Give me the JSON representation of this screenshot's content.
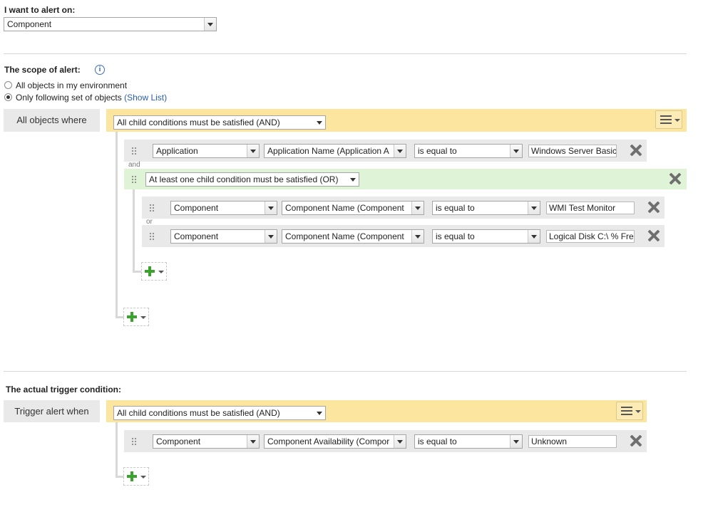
{
  "alert_on": {
    "label": "I want to alert on:",
    "value": "Component"
  },
  "scope": {
    "title": "The scope of alert:",
    "info_icon": "info-icon",
    "options": [
      {
        "label": "All objects in my environment",
        "selected": false
      },
      {
        "label": "Only following set of objects",
        "selected": true
      }
    ],
    "show_list": "(Show List)",
    "side_label": "All objects where",
    "root_condition": "All child conditions must be satisfied (AND)",
    "and_label": "and",
    "row1": {
      "object": "Application",
      "property": "Application Name (Application A",
      "operator": "is equal to",
      "value": "Windows Server Basic"
    },
    "or_group": {
      "condition": "At least one child condition must be satisfied (OR)",
      "or_label": "or",
      "rows": [
        {
          "object": "Component",
          "property": "Component Name (Component",
          "operator": "is equal to",
          "value": "WMI Test Monitor"
        },
        {
          "object": "Component",
          "property": "Component Name (Component",
          "operator": "is equal to",
          "value": "Logical Disk C:\\ % Fre"
        }
      ]
    }
  },
  "trigger": {
    "title": "The actual trigger condition:",
    "side_label": "Trigger alert when",
    "root_condition": "All child conditions must be satisfied (AND)",
    "row1": {
      "object": "Component",
      "property": "Component Availability (Compor",
      "operator": "is equal to",
      "value": "Unknown"
    }
  },
  "colors": {
    "and_bar": "#fce59e",
    "or_bar": "#dff3d6",
    "row_bg": "#e9e9e9",
    "plus": "#3aa32c",
    "link": "#2a5db0"
  }
}
